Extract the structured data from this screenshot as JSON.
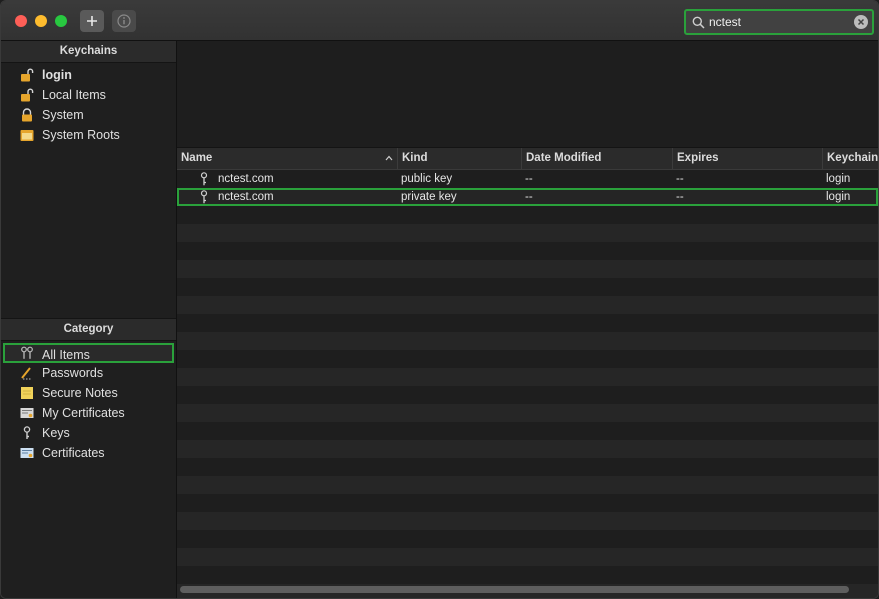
{
  "toolbar": {
    "add_icon": "plus-icon",
    "info_icon": "info-icon",
    "search": {
      "value": "nctest",
      "placeholder": "Search"
    }
  },
  "keychains": {
    "header": "Keychains",
    "items": [
      {
        "label": "login",
        "icon": "lock-open-icon"
      },
      {
        "label": "Local Items",
        "icon": "lock-open-icon"
      },
      {
        "label": "System",
        "icon": "lock-icon"
      },
      {
        "label": "System Roots",
        "icon": "folder-icon"
      }
    ]
  },
  "category": {
    "header": "Category",
    "items": [
      {
        "label": "All Items",
        "icon": "keys-icon"
      },
      {
        "label": "Passwords",
        "icon": "pencil-icon"
      },
      {
        "label": "Secure Notes",
        "icon": "note-icon"
      },
      {
        "label": "My Certificates",
        "icon": "certificate-icon"
      },
      {
        "label": "Keys",
        "icon": "key-icon"
      },
      {
        "label": "Certificates",
        "icon": "certificate-icon"
      }
    ]
  },
  "table": {
    "columns": [
      "Name",
      "Kind",
      "Date Modified",
      "Expires",
      "Keychain"
    ],
    "rows": [
      {
        "name": "nctest.com",
        "kind": "public key",
        "date_modified": "--",
        "expires": "--",
        "keychain": "login"
      },
      {
        "name": "nctest.com",
        "kind": "private key",
        "date_modified": "--",
        "expires": "--",
        "keychain": "login"
      }
    ]
  },
  "colors": {
    "highlight": "#2aa13b"
  }
}
